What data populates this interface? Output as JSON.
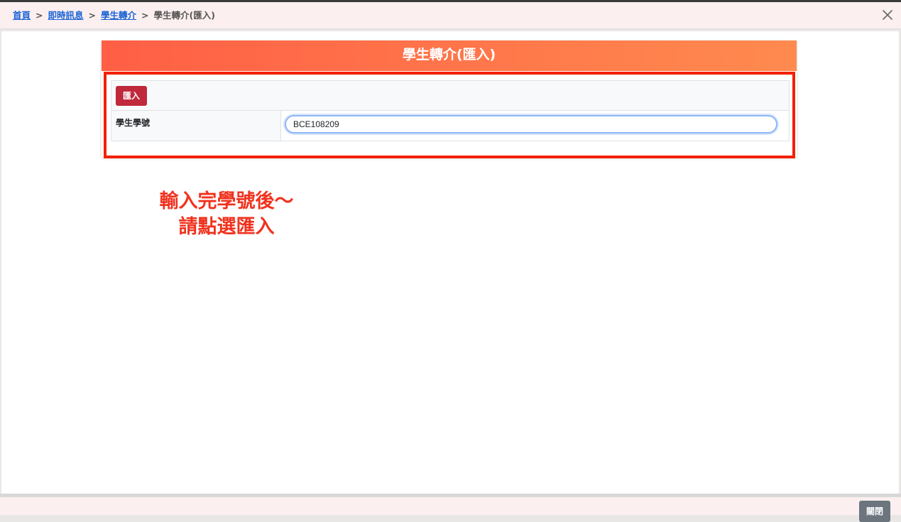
{
  "breadcrumb": {
    "items": [
      "首頁",
      "即時訊息",
      "學生轉介"
    ],
    "separator": ">",
    "current": "學生轉介(匯入)"
  },
  "card": {
    "title": "學生轉介(匯入)",
    "import_button_label": "匯入",
    "student_id_label": "學生學號",
    "student_id_value": "BCE108209"
  },
  "annotation": {
    "line1": "輸入完學號後～",
    "line2": "請點選匯入"
  },
  "footer": {
    "close_button_label": "關閉"
  },
  "colors": {
    "header_gradient_start": "#ff5f45",
    "header_gradient_end": "#ff8a4f",
    "highlight_border": "#f41f00",
    "annotation_text": "#f0321e",
    "import_button": "#c0283c",
    "link": "#1a63d8"
  },
  "icons": {
    "close": "close-icon"
  }
}
